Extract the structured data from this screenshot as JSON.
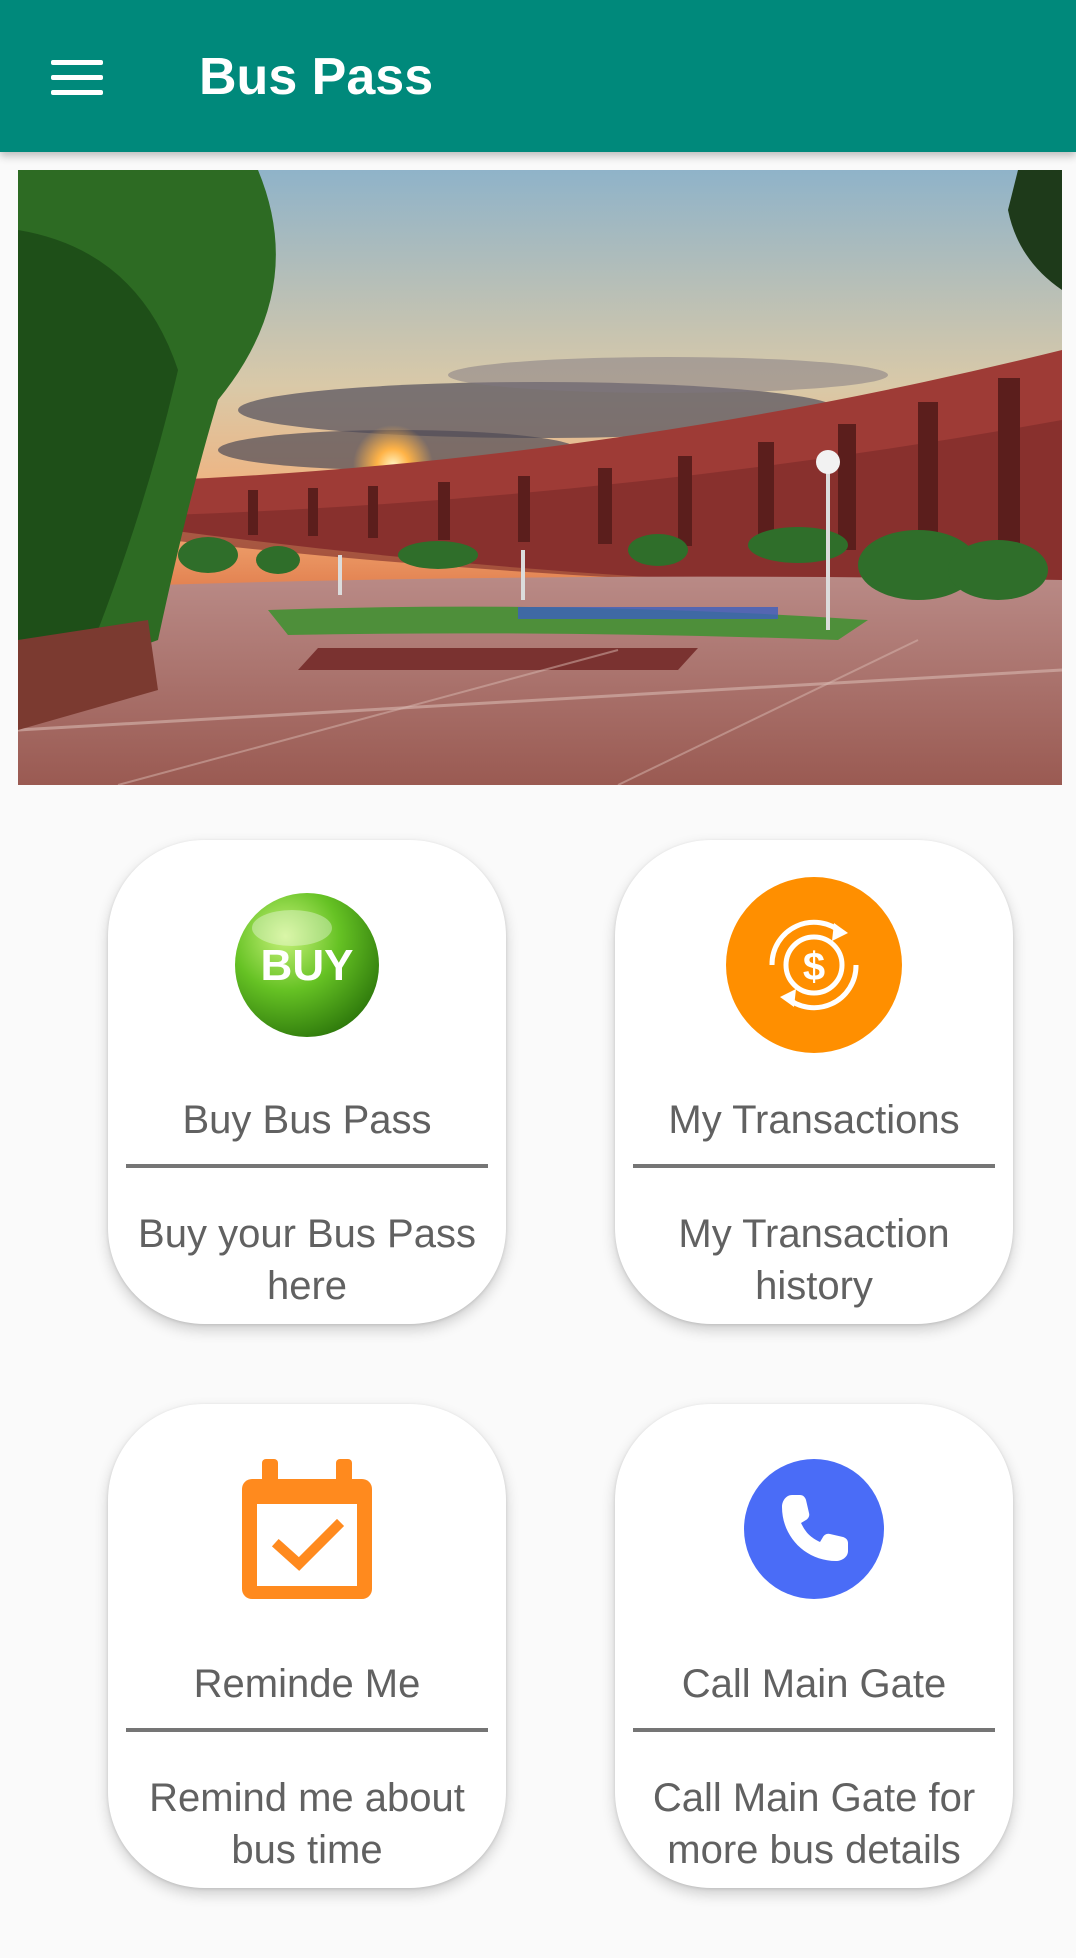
{
  "appbar": {
    "title": "Bus Pass",
    "menu_icon": "hamburger-menu-icon",
    "color": "#00897b"
  },
  "hero": {
    "image": "campus-sunset-photo"
  },
  "cards": [
    {
      "title": "Buy Bus Pass",
      "subtitle": "Buy your Bus Pass here",
      "icon": "buy-icon",
      "icon_text": "BUY",
      "icon_color": "#66c224"
    },
    {
      "title": "My Transactions",
      "subtitle": "My Transaction history",
      "icon": "dollar-exchange-icon",
      "icon_color": "#ff8f00"
    },
    {
      "title": "Reminde Me",
      "subtitle": "Remind me about bus time",
      "icon": "calendar-check-icon",
      "icon_color": "#ff8a1e"
    },
    {
      "title": "Call Main Gate",
      "subtitle": "Call Main Gate for more bus details",
      "icon": "phone-icon",
      "icon_color": "#4a6cf7"
    }
  ]
}
